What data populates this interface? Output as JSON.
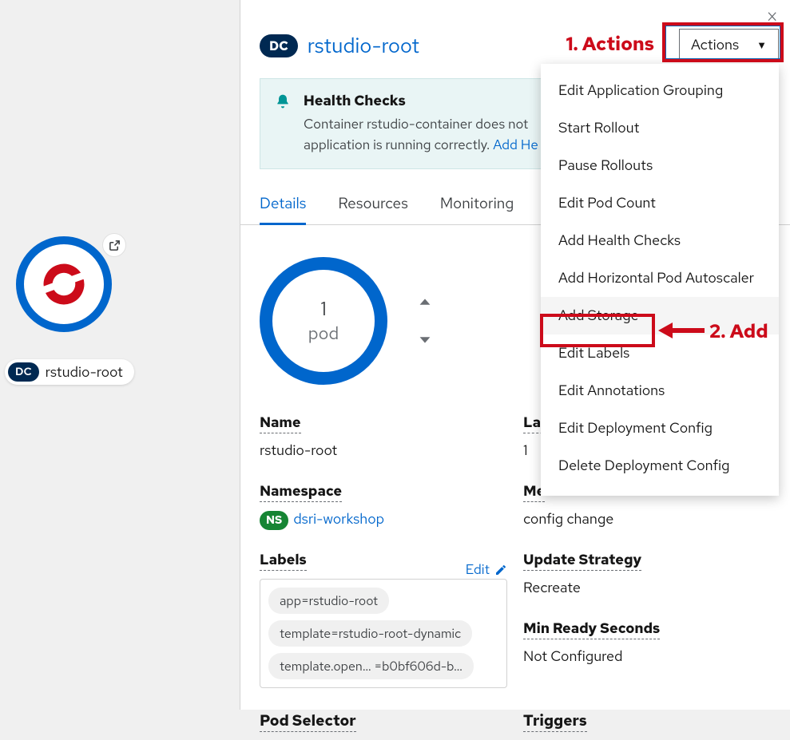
{
  "topology": {
    "node_label": "rstudio-root",
    "node_badge": "DC"
  },
  "panel": {
    "badge": "DC",
    "title": "rstudio-root"
  },
  "alert": {
    "title": "Health Checks",
    "text_a": "Container rstudio-container does not ",
    "text_b": "application is running correctly. ",
    "link": "Add He"
  },
  "tabs": [
    "Details",
    "Resources",
    "Monitoring"
  ],
  "active_tab": 0,
  "pod": {
    "count": "1",
    "label": "pod"
  },
  "details": {
    "name_label": "Name",
    "name_value": "rstudio-root",
    "latest_label": "Lat",
    "latest_value": "1",
    "namespace_label": "Namespace",
    "namespace_badge": "NS",
    "namespace_value": "dsri-workshop",
    "me_label": "Me",
    "me_value": "config change",
    "labels_label": "Labels",
    "labels_edit": "Edit",
    "labels_chips": [
      "app=rstudio-root",
      "template=rstudio-root-dynamic",
      "template.open… =b0bf606d-b…"
    ],
    "update_strategy_label": "Update Strategy",
    "update_strategy_value": "Recreate",
    "min_ready_label": "Min Ready Seconds",
    "min_ready_value": "Not Configured",
    "pod_selector_label": "Pod Selector",
    "triggers_label": "Triggers"
  },
  "actions": {
    "button_label": "Actions",
    "items": [
      "Edit Application Grouping",
      "Start Rollout",
      "Pause Rollouts",
      "Edit Pod Count",
      "Add Health Checks",
      "Add Horizontal Pod Autoscaler",
      "Add Storage",
      "Edit Labels",
      "Edit Annotations",
      "Edit Deployment Config",
      "Delete Deployment Config"
    ]
  },
  "annotations": {
    "one": "1. Actions",
    "two": "2. Add"
  }
}
